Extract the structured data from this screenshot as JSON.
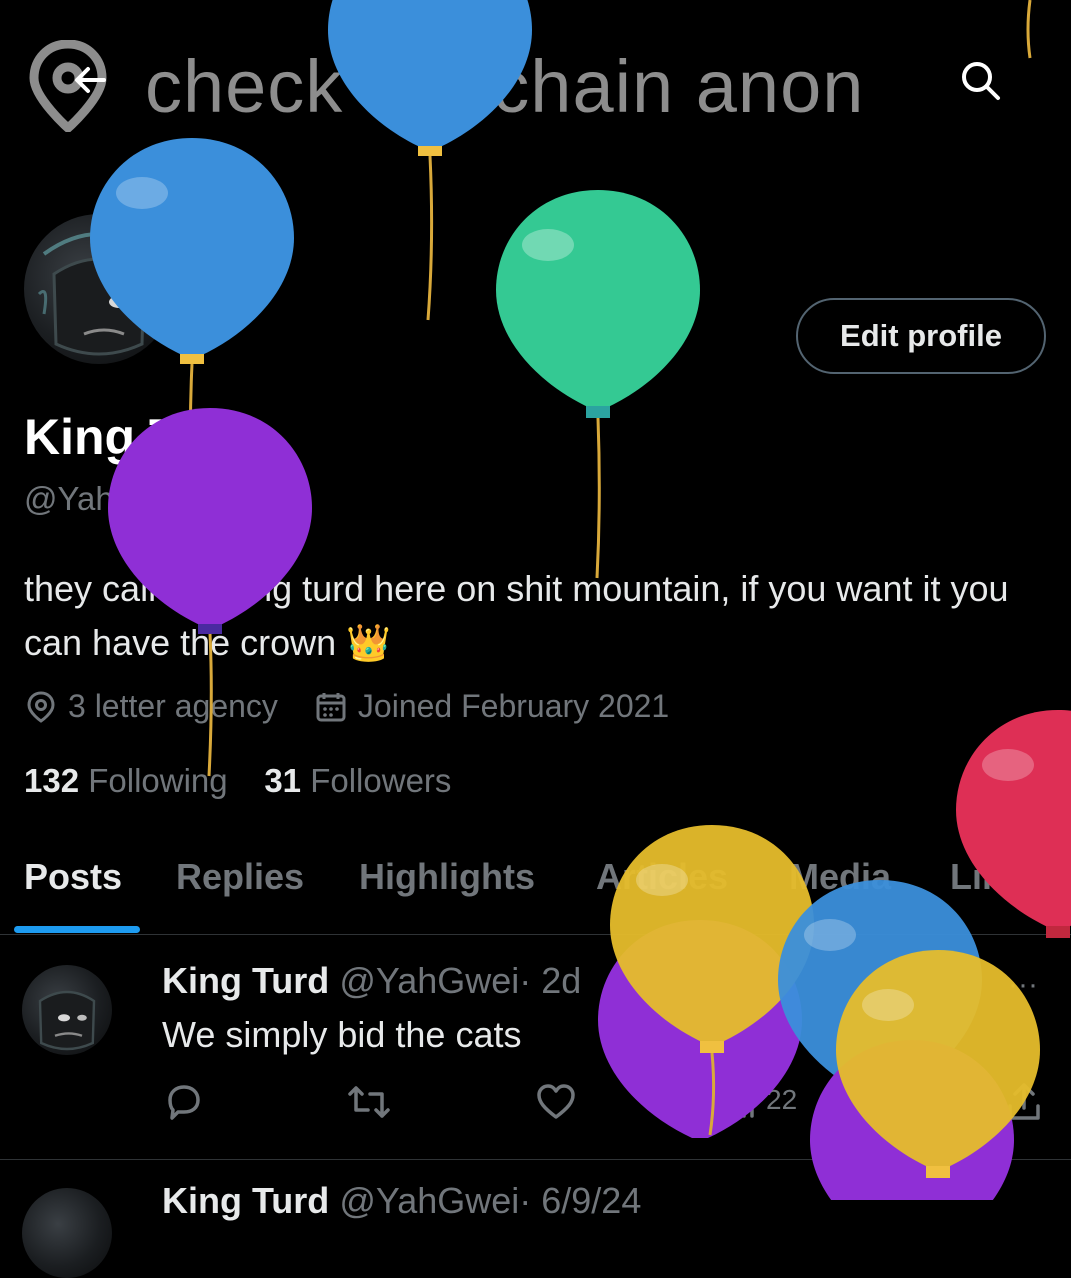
{
  "banner": {
    "text": "check the chain anon"
  },
  "profile": {
    "display_name": "King Turd",
    "handle": "@YahGwei",
    "bio": "they call me king turd here on shit mountain, if you want it you can have the crown",
    "bio_emoji": "👑",
    "location": "3 letter agency",
    "joined": "Joined February 2021",
    "following_count": "132",
    "following_label": "Following",
    "followers_count": "31",
    "followers_label": "Followers",
    "edit_label": "Edit profile"
  },
  "tabs": [
    "Posts",
    "Replies",
    "Highlights",
    "Articles",
    "Media",
    "Likes"
  ],
  "active_tab": "Posts",
  "posts": [
    {
      "name": "King Turd",
      "handle": "@YahGwei",
      "time": "· 2d",
      "text": "We simply bid the cats",
      "views": "22",
      "more": "···"
    },
    {
      "name": "King Turd",
      "handle": "@YahGwei",
      "time": "· 6/9/24"
    }
  ],
  "colors": {
    "accent": "#1d9bf0",
    "muted": "#71767b",
    "text": "#e7e9ea",
    "border": "#2f3336"
  },
  "icons": [
    "back-arrow-icon",
    "search-icon",
    "location-pin-icon",
    "calendar-icon",
    "reply-icon",
    "repost-icon",
    "like-icon",
    "views-icon",
    "share-icon",
    "balloon-icon"
  ]
}
